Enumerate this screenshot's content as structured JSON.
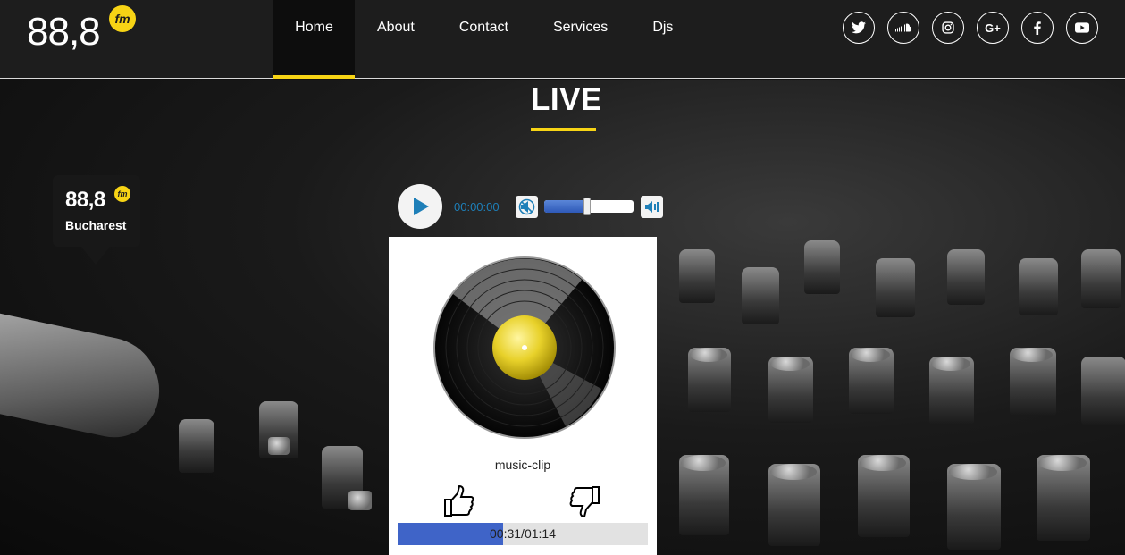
{
  "brand": {
    "logo_text": "88,8",
    "fm": "fm"
  },
  "nav": {
    "items": [
      {
        "label": "Home",
        "active": true
      },
      {
        "label": "About"
      },
      {
        "label": "Contact"
      },
      {
        "label": "Services"
      },
      {
        "label": "Djs"
      }
    ]
  },
  "social": [
    "twitter-icon",
    "soundcloud-icon",
    "instagram-icon",
    "google-plus-icon",
    "facebook-icon",
    "youtube-icon"
  ],
  "hero": {
    "title": "LIVE",
    "station": {
      "number": "88,8",
      "fm": "fm",
      "city": "Bucharest"
    }
  },
  "player": {
    "time": "00:00:00",
    "volume": 0.48,
    "track_name": "music-clip",
    "progress_text": "00:31/01:14",
    "progress": 0.42
  },
  "colors": {
    "accent": "#f7d415",
    "progress": "#3f64c8",
    "time": "#1e7fb8"
  }
}
